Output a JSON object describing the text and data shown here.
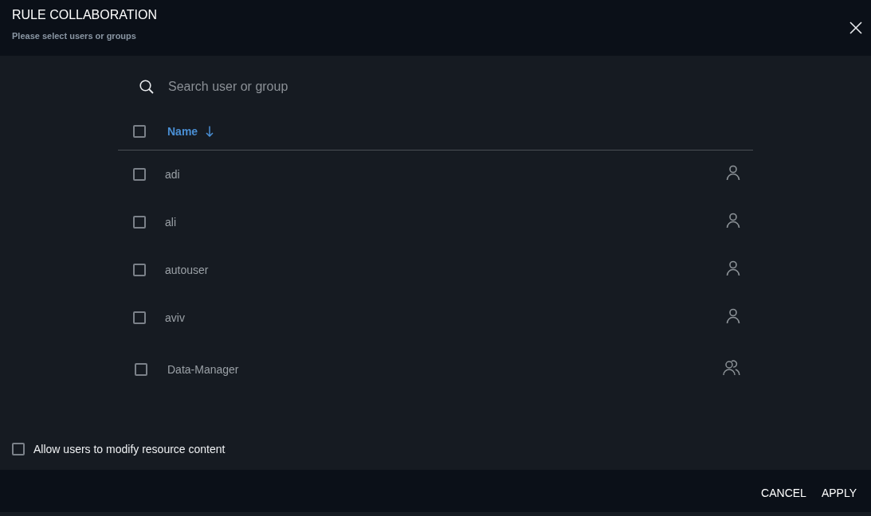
{
  "dialog": {
    "title": "RULE COLLABORATION",
    "subtitle": "Please select users or groups"
  },
  "search": {
    "placeholder": "Search user or group"
  },
  "table": {
    "select_all": {
      "checked": false
    },
    "columns": [
      {
        "label": "Name",
        "sorted": true
      }
    ],
    "rows": [
      {
        "name": "adi",
        "kind": "user",
        "checked": false
      },
      {
        "name": "ali",
        "kind": "user",
        "checked": false
      },
      {
        "name": "autouser",
        "kind": "user",
        "checked": false
      },
      {
        "name": "aviv",
        "kind": "user",
        "checked": false
      },
      {
        "name": "Data-Manager",
        "kind": "group",
        "checked": false
      }
    ]
  },
  "option": {
    "label": "Allow users to modify resource content",
    "checked": false
  },
  "buttons": [
    {
      "label": "CANCEL"
    },
    {
      "label": "APPLY"
    }
  ]
}
